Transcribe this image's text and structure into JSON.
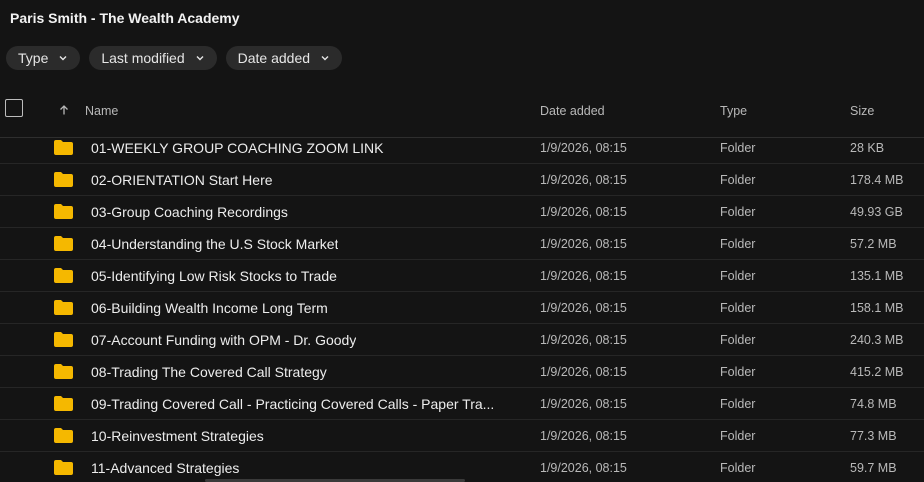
{
  "window": {
    "title": "Paris Smith - The Wealth Academy"
  },
  "filters": [
    {
      "label": "Type",
      "icon": "chevron-down-icon"
    },
    {
      "label": "Last modified",
      "icon": "chevron-down-icon"
    },
    {
      "label": "Date added",
      "icon": "chevron-down-icon"
    }
  ],
  "table": {
    "sort": {
      "column": "Name",
      "direction": "ascending",
      "icon": "arrow-up-icon"
    },
    "columns": {
      "name": "Name",
      "date_added": "Date added",
      "type": "Type",
      "size": "Size"
    },
    "rows": [
      {
        "name": "01-WEEKLY GROUP COACHING ZOOM LINK",
        "date_added": "1/9/2026, 08:15",
        "type": "Folder",
        "size": "28 KB"
      },
      {
        "name": "02-ORIENTATION Start Here",
        "date_added": "1/9/2026, 08:15",
        "type": "Folder",
        "size": "178.4 MB"
      },
      {
        "name": "03-Group Coaching Recordings",
        "date_added": "1/9/2026, 08:15",
        "type": "Folder",
        "size": "49.93 GB"
      },
      {
        "name": "04-Understanding the U.S Stock Market",
        "date_added": "1/9/2026, 08:15",
        "type": "Folder",
        "size": "57.2 MB"
      },
      {
        "name": "05-Identifying Low Risk Stocks to Trade",
        "date_added": "1/9/2026, 08:15",
        "type": "Folder",
        "size": "135.1 MB"
      },
      {
        "name": "06-Building Wealth Income Long Term",
        "date_added": "1/9/2026, 08:15",
        "type": "Folder",
        "size": "158.1 MB"
      },
      {
        "name": "07-Account Funding with OPM - Dr. Goody",
        "date_added": "1/9/2026, 08:15",
        "type": "Folder",
        "size": "240.3 MB"
      },
      {
        "name": "08-Trading The Covered Call Strategy",
        "date_added": "1/9/2026, 08:15",
        "type": "Folder",
        "size": "415.2 MB"
      },
      {
        "name": "09-Trading Covered Call - Practicing Covered Calls - Paper Tra...",
        "date_added": "1/9/2026, 08:15",
        "type": "Folder",
        "size": "74.8 MB"
      },
      {
        "name": "10-Reinvestment Strategies",
        "date_added": "1/9/2026, 08:15",
        "type": "Folder",
        "size": "77.3 MB"
      },
      {
        "name": "11-Advanced Strategies",
        "date_added": "1/9/2026, 08:15",
        "type": "Folder",
        "size": "59.7 MB"
      }
    ]
  },
  "colors": {
    "background": "#141414",
    "chip": "#2b2b2b",
    "folder": "#f5b800"
  }
}
